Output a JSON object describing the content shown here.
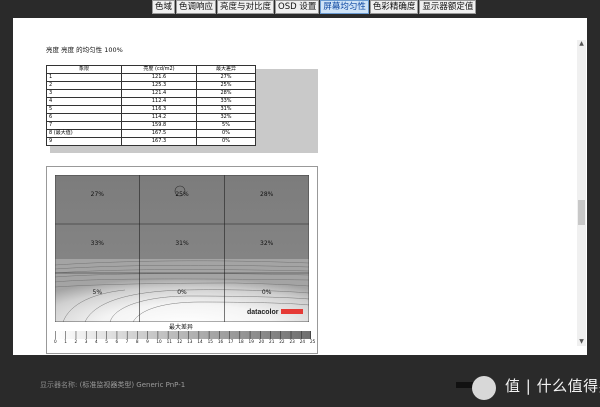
{
  "tabs": [
    {
      "label": "色域",
      "active": false
    },
    {
      "label": "色调响应",
      "active": false
    },
    {
      "label": "亮度与对比度",
      "active": false
    },
    {
      "label": "OSD 设置",
      "active": false
    },
    {
      "label": "屏幕均匀性",
      "active": true
    },
    {
      "label": "色彩精确度",
      "active": false
    },
    {
      "label": "显示器额定值",
      "active": false
    }
  ],
  "toolbar": {
    "icons": [
      "zoom-in-icon",
      "zoom-out-icon",
      "zoom-reset-icon"
    ]
  },
  "report": {
    "heading": "亮度  亮度  的均匀性  100%",
    "table": {
      "headers": [
        "象限",
        "亮度 (cd/m2)",
        "最大差异"
      ],
      "rows": [
        [
          "1",
          "121.6",
          "27%"
        ],
        [
          "2",
          "125.3",
          "25%"
        ],
        [
          "3",
          "121.4",
          "28%"
        ],
        [
          "4",
          "112.4",
          "33%"
        ],
        [
          "5",
          "116.3",
          "31%"
        ],
        [
          "6",
          "114.2",
          "32%"
        ],
        [
          "7",
          "159.8",
          "5%"
        ],
        [
          "8 (最大值)",
          "167.5",
          "0%"
        ],
        [
          "9",
          "167.3",
          "0%"
        ]
      ]
    },
    "uniformity_chart": {
      "cells": [
        "27%",
        "25%",
        "28%",
        "33%",
        "31%",
        "32%",
        "5%",
        "0%",
        "0%"
      ],
      "brand": "datacolor",
      "scale_title": "最大差异",
      "scale_ticks": [
        "0",
        "1",
        "2",
        "3",
        "4",
        "5",
        "6",
        "7",
        "8",
        "9",
        "10",
        "11",
        "12",
        "13",
        "14",
        "15",
        "16",
        "17",
        "18",
        "19",
        "20",
        "21",
        "22",
        "23",
        "24",
        "25"
      ]
    }
  },
  "footer": {
    "label": "显示器名称:",
    "value": "(标准监视器类型) Generic PnP-1"
  },
  "watermark": "值 | 什么值得买",
  "colors": {
    "active_tab": "#cfe3f7",
    "chart_gray": "#7a7a7a",
    "brand_red": "#e53935"
  }
}
